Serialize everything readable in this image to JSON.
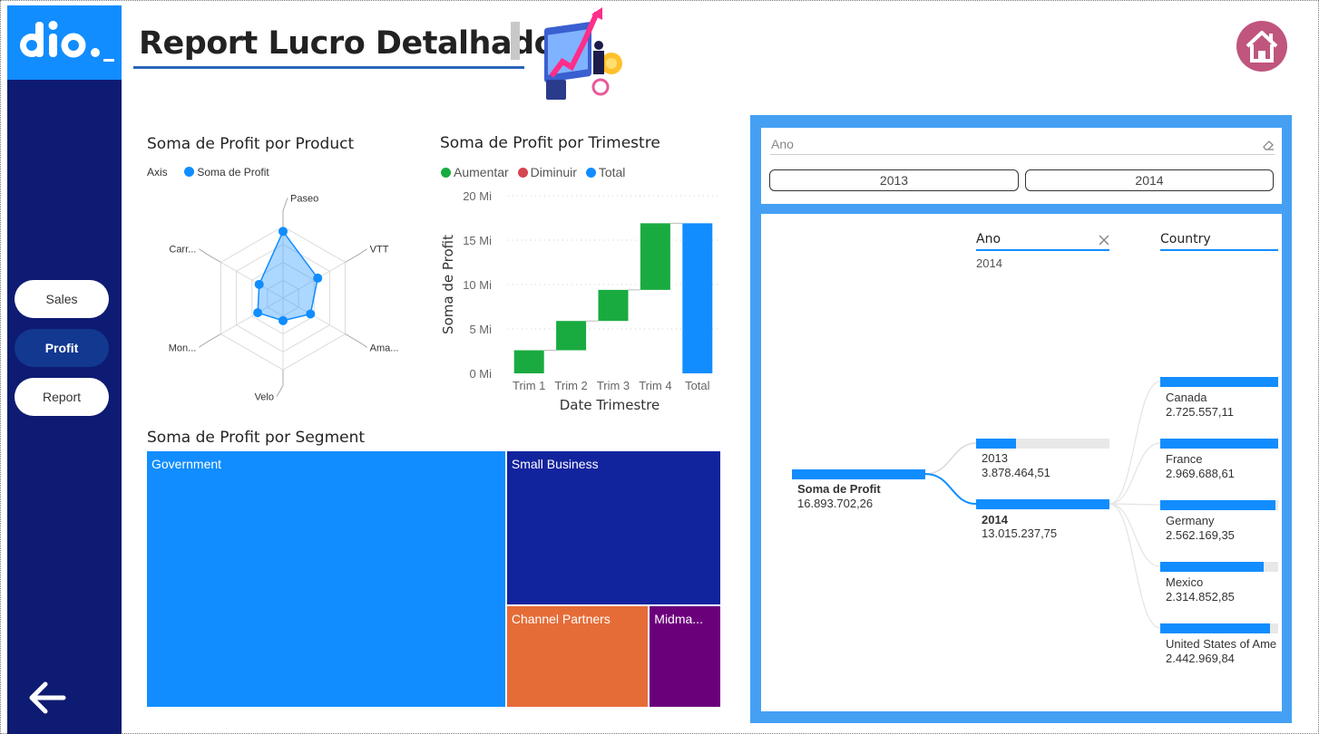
{
  "header": {
    "title": "Report Lucro Detalhado",
    "logo_text": "dio._"
  },
  "sidebar": {
    "items": [
      {
        "label": "Sales",
        "active": false
      },
      {
        "label": "Profit",
        "active": true
      },
      {
        "label": "Report",
        "active": false
      }
    ],
    "back_icon": "arrow-left-icon"
  },
  "icons": {
    "home": "home-icon",
    "clear": "eraser-icon",
    "remove": "close-icon"
  },
  "colors": {
    "sidebar": "#0e1b72",
    "accent": "#118dff",
    "increase": "#1aab40",
    "decrease": "#d64550",
    "total": "#118dff",
    "home": "#c0557e"
  },
  "radar": {
    "title": "Soma de Profit por Product",
    "legend_axis": "Axis",
    "legend_series": "Soma de Profit"
  },
  "waterfall": {
    "title": "Soma de Profit por Trimestre",
    "legend": [
      "Aumentar",
      "Diminuir",
      "Total"
    ],
    "xlabel": "Date Trimestre",
    "ylabel": "Soma de Profit"
  },
  "treemap": {
    "title": "Soma de Profit por Segment"
  },
  "slicer": {
    "title": "Ano",
    "options": [
      "2013",
      "2014"
    ]
  },
  "decomposition": {
    "root": {
      "label": "Soma de Profit",
      "value": "16.893.702,26"
    },
    "level1": {
      "header": "Ano",
      "filter": "2014"
    },
    "level2": {
      "header": "Country"
    },
    "years": [
      {
        "label": "2013",
        "value": "3.878.464,51",
        "fill": 0.3
      },
      {
        "label": "2014",
        "value": "13.015.237,75",
        "fill": 1.0
      }
    ],
    "countries": [
      {
        "label": "Canada",
        "value": "2.725.557,11",
        "fill": 1.0
      },
      {
        "label": "France",
        "value": "2.969.688,61",
        "fill": 1.0
      },
      {
        "label": "Germany",
        "value": "2.562.169,35",
        "fill": 0.98
      },
      {
        "label": "Mexico",
        "value": "2.314.852,85",
        "fill": 0.88
      },
      {
        "label": "United States of Ame",
        "value": "2.442.969,84",
        "fill": 0.93
      }
    ]
  },
  "chart_data": [
    {
      "type": "radar",
      "title": "Soma de Profit por Product",
      "categories": [
        "Paseo",
        "VTT",
        "Ama...",
        "Velo",
        "Mon...",
        "Carr..."
      ],
      "series": [
        {
          "name": "Soma de Profit",
          "values": [
            0.8,
            0.48,
            0.38,
            0.27,
            0.35,
            0.33
          ]
        }
      ]
    },
    {
      "type": "waterfall",
      "title": "Soma de Profit por Trimestre",
      "categories": [
        "Trim 1",
        "Trim 2",
        "Trim 3",
        "Trim 4",
        "Total"
      ],
      "steps": [
        {
          "start": 0,
          "end": 2.6,
          "kind": "Aumentar"
        },
        {
          "start": 2.6,
          "end": 5.9,
          "kind": "Aumentar"
        },
        {
          "start": 5.9,
          "end": 9.4,
          "kind": "Aumentar"
        },
        {
          "start": 9.4,
          "end": 16.9,
          "kind": "Aumentar"
        },
        {
          "start": 0,
          "end": 16.9,
          "kind": "Total"
        }
      ],
      "yticks": [
        "0 Mi",
        "5 Mi",
        "10 Mi",
        "15 Mi",
        "20 Mi"
      ],
      "ylim": [
        0,
        20
      ],
      "xlabel": "Date Trimestre",
      "ylabel": "Soma de Profit"
    },
    {
      "type": "treemap",
      "title": "Soma de Profit por Segment",
      "items": [
        {
          "label": "Government",
          "value": 11.4,
          "color": "#118dff"
        },
        {
          "label": "Small Business",
          "value": 4.1,
          "color": "#12239e"
        },
        {
          "label": "Channel Partners",
          "value": 1.8,
          "color": "#e66c37"
        },
        {
          "label": "Midma...",
          "value": 0.9,
          "color": "#6b007b"
        }
      ]
    }
  ]
}
